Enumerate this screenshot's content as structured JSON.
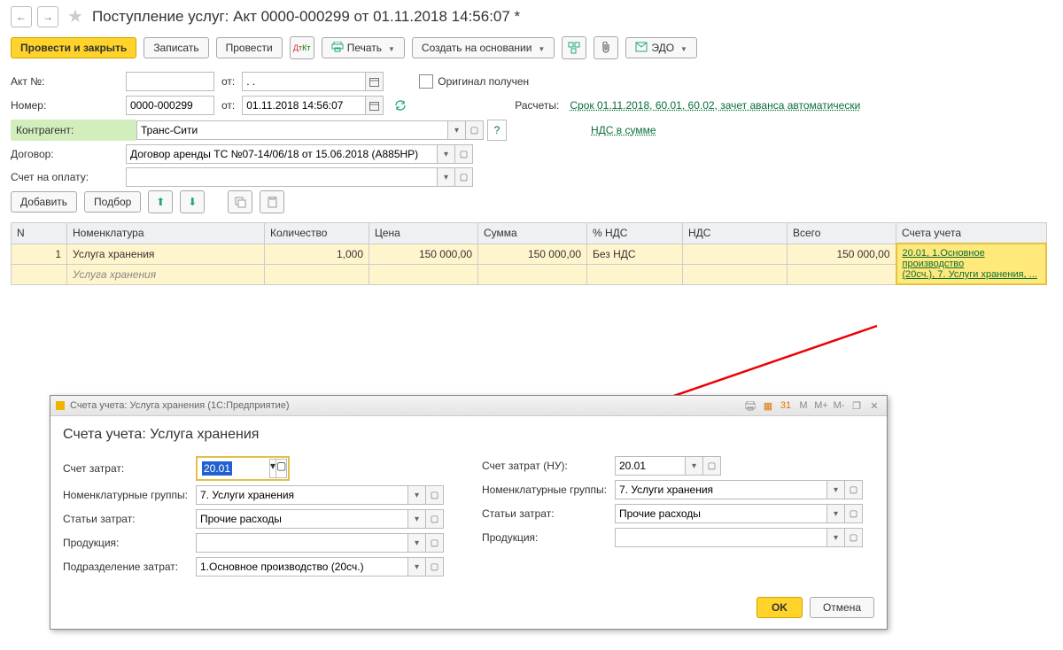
{
  "header": {
    "title": "Поступление услуг: Акт 0000-000299 от 01.11.2018 14:56:07 *"
  },
  "toolbar": {
    "post_close": "Провести и закрыть",
    "save": "Записать",
    "post": "Провести",
    "print": "Печать",
    "create_based": "Создать на основании",
    "edo": "ЭДО"
  },
  "form": {
    "act_no_lbl": "Акт №:",
    "act_no_val": "",
    "from_lbl": "от:",
    "act_date_val": ". .",
    "number_lbl": "Номер:",
    "number_val": "0000-000299",
    "number_date_val": "01.11.2018 14:56:07",
    "orig_received": "Оригинал получен",
    "calc_lbl": "Расчеты:",
    "calc_link": "Срок 01.11.2018, 60.01, 60.02, зачет аванса автоматически",
    "nds_link": "НДС в сумме",
    "counterparty_lbl": "Контрагент:",
    "counterparty_val": "Транс-Сити",
    "contract_lbl": "Договор:",
    "contract_val": "Договор аренды ТС №07-14/06/18 от 15.06.2018 (А885НР)",
    "invoice_lbl": "Счет на оплату:",
    "invoice_val": "",
    "add_btn": "Добавить",
    "pick_btn": "Подбор"
  },
  "table": {
    "headers": {
      "n": "N",
      "nomen": "Номенклатура",
      "qty": "Количество",
      "price": "Цена",
      "sum": "Сумма",
      "nds_pct": "% НДС",
      "nds": "НДС",
      "total": "Всего",
      "accounts": "Счета учета"
    },
    "row": {
      "n": "1",
      "nomen": "Услуга хранения",
      "nomen2": "Услуга хранения",
      "qty": "1,000",
      "price": "150 000,00",
      "sum": "150 000,00",
      "nds_pct": "Без НДС",
      "nds": "",
      "total": "150 000,00",
      "acc1": "20.01, 1.Основное производство",
      "acc2": "(20сч.), 7. Услуги хранения, ..."
    }
  },
  "dialog": {
    "win_title": "Счета учета: Услуга хранения  (1С:Предприятие)",
    "title": "Счета учета: Услуга хранения",
    "cost_acc_lbl": "Счет затрат:",
    "cost_acc_val": "20.01",
    "nomen_grp_lbl": "Номенклатурные группы:",
    "nomen_grp_val": "7. Услуги хранения",
    "cost_item_lbl": "Статьи затрат:",
    "cost_item_val": "Прочие расходы",
    "product_lbl": "Продукция:",
    "product_val": "",
    "dept_lbl": "Подразделение затрат:",
    "dept_val": "1.Основное производство (20сч.)",
    "cost_acc_nu_lbl": "Счет затрат (НУ):",
    "cost_acc_nu_val": "20.01",
    "ok": "OK",
    "cancel": "Отмена",
    "m": "M",
    "mp": "M+",
    "mm": "M-"
  }
}
